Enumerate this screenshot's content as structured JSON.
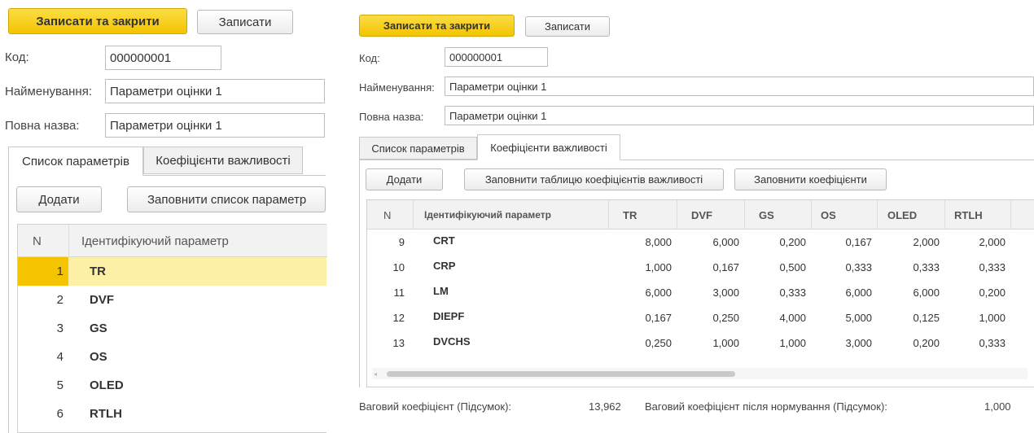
{
  "left": {
    "buttons": {
      "save_close": "Записати та закрити",
      "save": "Записати"
    },
    "labels": {
      "code": "Код:",
      "name": "Найменування:",
      "full_name": "Повна назва:"
    },
    "values": {
      "code": "000000001",
      "name": "Параметри оцінки 1",
      "full_name": "Параметри оцінки 1"
    },
    "tabs": [
      "Список параметрів",
      "Коефіцієнти важливості"
    ],
    "toolbar": {
      "add": "Додати",
      "fill": "Заповнити список параметр"
    },
    "table": {
      "headers": [
        "N",
        "Ідентифікуючий параметр"
      ],
      "rows": [
        {
          "n": "1",
          "id": "TR"
        },
        {
          "n": "2",
          "id": "DVF"
        },
        {
          "n": "3",
          "id": "GS"
        },
        {
          "n": "4",
          "id": "OS"
        },
        {
          "n": "5",
          "id": "OLED"
        },
        {
          "n": "6",
          "id": "RTLH"
        }
      ]
    }
  },
  "right": {
    "buttons": {
      "save_close": "Записати та закрити",
      "save": "Записати"
    },
    "labels": {
      "code": "Код:",
      "name": "Найменування:",
      "full_name": "Повна назва:"
    },
    "values": {
      "code": "000000001",
      "name": "Параметри оцінки 1",
      "full_name": "Параметри оцінки 1"
    },
    "tabs": [
      "Список параметрів",
      "Коефіцієнти важливості"
    ],
    "toolbar": {
      "add": "Додати",
      "fill_table": "Заповнити таблицю коефіцієнтів важливості",
      "fill_coef": "Заповнити коефіцієнти"
    },
    "table": {
      "headers": [
        "N",
        "Ідентифікуючий параметр",
        "TR",
        "DVF",
        "GS",
        "OS",
        "OLED",
        "RTLH"
      ],
      "rows": [
        {
          "n": "9",
          "id": "CRT",
          "vals": [
            "8,000",
            "6,000",
            "0,200",
            "0,167",
            "2,000",
            "2,000"
          ]
        },
        {
          "n": "10",
          "id": "CRP",
          "vals": [
            "1,000",
            "0,167",
            "0,500",
            "0,333",
            "0,333",
            "0,333"
          ]
        },
        {
          "n": "11",
          "id": "LM",
          "vals": [
            "6,000",
            "3,000",
            "0,333",
            "6,000",
            "6,000",
            "0,200"
          ]
        },
        {
          "n": "12",
          "id": "DIEPF",
          "vals": [
            "0,167",
            "0,250",
            "4,000",
            "5,000",
            "0,125",
            "1,000"
          ]
        },
        {
          "n": "13",
          "id": "DVCHS",
          "vals": [
            "0,250",
            "1,000",
            "1,000",
            "3,000",
            "0,200",
            "0,333"
          ]
        }
      ]
    },
    "footer": {
      "weight_label": "Ваговий коефіцієнт (Підсумок):",
      "weight_value": "13,962",
      "norm_label": "Ваговий коефіцієнт після нормування (Підсумок):",
      "norm_value": "1,000"
    }
  },
  "colors": {
    "accent_yellow": "#f5c800",
    "selected_row": "#fcefa6",
    "selected_cell": "#f5c400"
  }
}
